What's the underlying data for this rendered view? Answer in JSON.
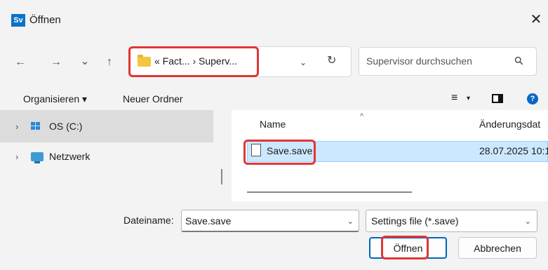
{
  "window": {
    "app_icon_text": "Sv",
    "title": "Öffnen",
    "close_glyph": "✕"
  },
  "nav": {
    "back_glyph": "←",
    "forward_glyph": "→",
    "recent_glyph": "⌄",
    "up_glyph": "↑",
    "address_text": "« Fact... › Superv...",
    "address_dropdown_glyph": "⌄",
    "refresh_glyph": "↻",
    "search_placeholder": "Supervisor durchsuchen",
    "search_glyph": "⚲"
  },
  "toolbar": {
    "organize_label": "Organisieren ▾",
    "new_folder_label": "Neuer Ordner",
    "view_glyph": "≡",
    "view_chevron": "▾",
    "help_glyph": "?"
  },
  "navigation_pane": {
    "items": [
      {
        "chevron": "›",
        "label": "OS (C:)",
        "selected": true
      },
      {
        "chevron": "›",
        "label": "Netzwerk",
        "selected": false
      }
    ]
  },
  "file_list": {
    "columns": {
      "name": "Name",
      "date": "Änderungsdat",
      "sort_glyph": "^"
    },
    "rows": [
      {
        "name": "Save.save",
        "modified": "28.07.2025 10:1",
        "selected": true
      }
    ]
  },
  "footer": {
    "filename_label": "Dateiname:",
    "filename_value": "Save.save",
    "filename_chevron": "⌄",
    "filetype_value": "Settings file (*.save)",
    "filetype_chevron": "⌄",
    "open_label": "Öffnen",
    "cancel_label": "Abbrechen"
  },
  "colors": {
    "highlight": "#e03636",
    "selection": "#cce8ff",
    "accent": "#0067c0",
    "chrome": "#f3f3f3"
  }
}
